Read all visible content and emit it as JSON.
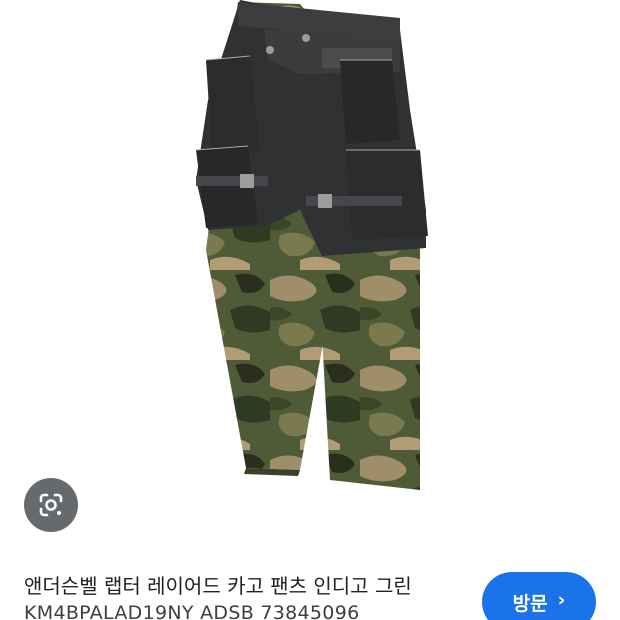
{
  "product": {
    "title": "앤더슨벨 랩터 레이어드 카고 팬츠 인디고 그린",
    "sku": "KM4BPALAD19NY ADSB 73845096"
  },
  "actions": {
    "visit_label": "방문",
    "visit_chevron": "›"
  },
  "icons": {
    "lens": "google-lens-icon",
    "chevron": "chevron-right-icon"
  },
  "colors": {
    "visit_button": "#1a73e8",
    "lens_button": "#3c4043",
    "denim": "#2f3133",
    "camo_base": "#5f6b45"
  }
}
